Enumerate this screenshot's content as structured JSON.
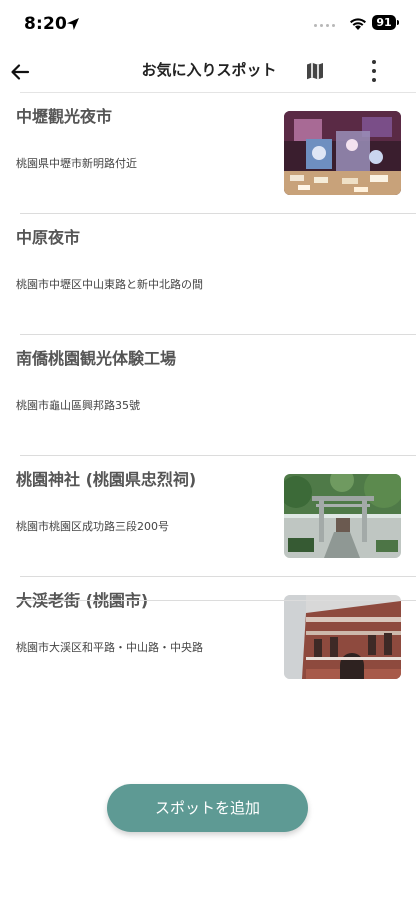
{
  "status_bar": {
    "time": "8:20",
    "battery": "91"
  },
  "app_bar": {
    "title": "お気に入りスポット",
    "icons": [
      "back-arrow-icon",
      "map-icon",
      "more-vert-icon"
    ]
  },
  "spots": [
    {
      "name": "中壢觀光夜市",
      "address": "桃園県中壢市新明路付近",
      "has_image": true,
      "image": "night-market-photo"
    },
    {
      "name": "中原夜市",
      "address": "桃園市中壢区中山東路と新中北路の間",
      "has_image": false
    },
    {
      "name": "南僑桃園観光体験工場",
      "address": "桃園市龜山區興邦路35號",
      "has_image": false
    },
    {
      "name": "桃園神社 (桃園県忠烈祠)",
      "address": "桃園市桃園区成功路三段200号",
      "has_image": true,
      "image": "shrine-gate-photo"
    },
    {
      "name": "大渓老街 (桃園市)",
      "address": "桃園市大渓区和平路・中山路・中央路",
      "has_image": true,
      "image": "old-street-building-photo"
    }
  ],
  "add_button": {
    "label": "スポットを追加"
  },
  "colors": {
    "accent": "#5e9a94",
    "divider": "#dcdcdc"
  }
}
